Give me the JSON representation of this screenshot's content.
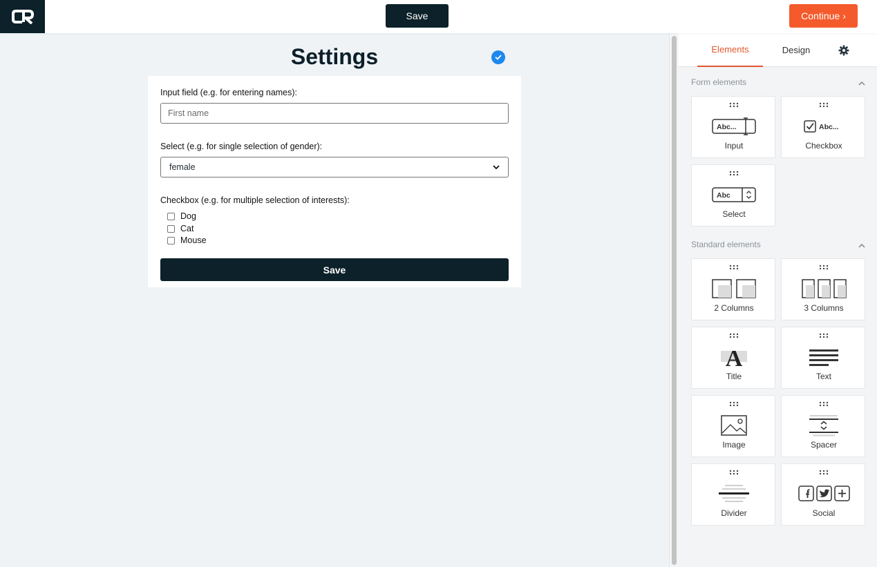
{
  "topbar": {
    "logo_text": "CR",
    "save_label": "Save",
    "continue_label": "Continue",
    "continue_chevron": "›"
  },
  "form": {
    "title": "Settings",
    "input_label": "Input field (e.g. for entering names):",
    "input_placeholder": "First name",
    "select_label": "Select (e.g. for single selection of gender):",
    "select_value": "female",
    "checkbox_label": "Checkbox (e.g. for multiple selection of interests):",
    "checkbox_options": [
      "Dog",
      "Cat",
      "Mouse"
    ],
    "save_label": "Save"
  },
  "panel": {
    "tabs": [
      {
        "label": "Elements",
        "active": true
      },
      {
        "label": "Design",
        "active": false
      },
      {
        "icon": "gear-icon"
      }
    ],
    "form_section": "Form elements",
    "form_elements": [
      {
        "label": "Input",
        "icon": "input-icon",
        "icon_text": "Abc..."
      },
      {
        "label": "Checkbox",
        "icon": "checkbox-icon",
        "icon_text": "Abc..."
      },
      {
        "label": "Select",
        "icon": "select-icon",
        "icon_text": "Abc"
      }
    ],
    "standard_section": "Standard elements",
    "standard_elements": [
      {
        "label": "2 Columns",
        "icon": "two-columns-icon"
      },
      {
        "label": "3 Columns",
        "icon": "three-columns-icon"
      },
      {
        "label": "Title",
        "icon": "title-icon",
        "icon_text": "A"
      },
      {
        "label": "Text",
        "icon": "text-icon"
      },
      {
        "label": "Image",
        "icon": "image-icon"
      },
      {
        "label": "Spacer",
        "icon": "spacer-icon"
      },
      {
        "label": "Divider",
        "icon": "divider-icon"
      },
      {
        "label": "Social",
        "icon": "social-icon"
      }
    ]
  },
  "colors": {
    "brand_dark": "#0c2129",
    "accent_orange": "#f55a2c",
    "tab_active": "#e4572e",
    "check_blue": "#1e88f0"
  }
}
